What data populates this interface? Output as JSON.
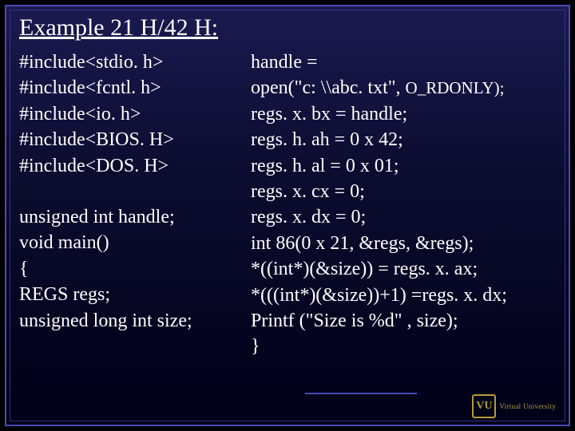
{
  "title": "Example 21 H/42 H:",
  "left": {
    "l1": "#include<stdio. h>",
    "l2": "#include<fcntl. h>",
    "l3": "#include<io. h>",
    "l4": "#include<BIOS. H>",
    "l5": "#include<DOS. H>",
    "l6": "unsigned int handle;",
    "l7": "void main()",
    "l8": "{",
    "l9": "REGS regs;",
    "l10": "unsigned long int size;"
  },
  "right": {
    "r1": "handle =",
    "r2a": "open(\"c: \\\\abc. txt\", ",
    "r2b": "O_RDONLY);",
    "r3": "regs. x. bx = handle;",
    "r4": "regs. h. ah = 0 x 42;",
    "r5": "regs. h. al = 0 x 01;",
    "r6": "regs. x. cx = 0;",
    "r7": "regs. x. dx = 0;",
    "r8": "int 86(0 x 21, &regs, &regs);",
    "r9": "*((int*)(&size)) = regs. x. ax;",
    "r10": "*(((int*)(&size))+1) =regs. x. dx;",
    "r11": "Printf (\"Size is %d\" , size);",
    "r12": "}"
  },
  "logo": {
    "badge": "VU",
    "line1": "Virtual University"
  }
}
